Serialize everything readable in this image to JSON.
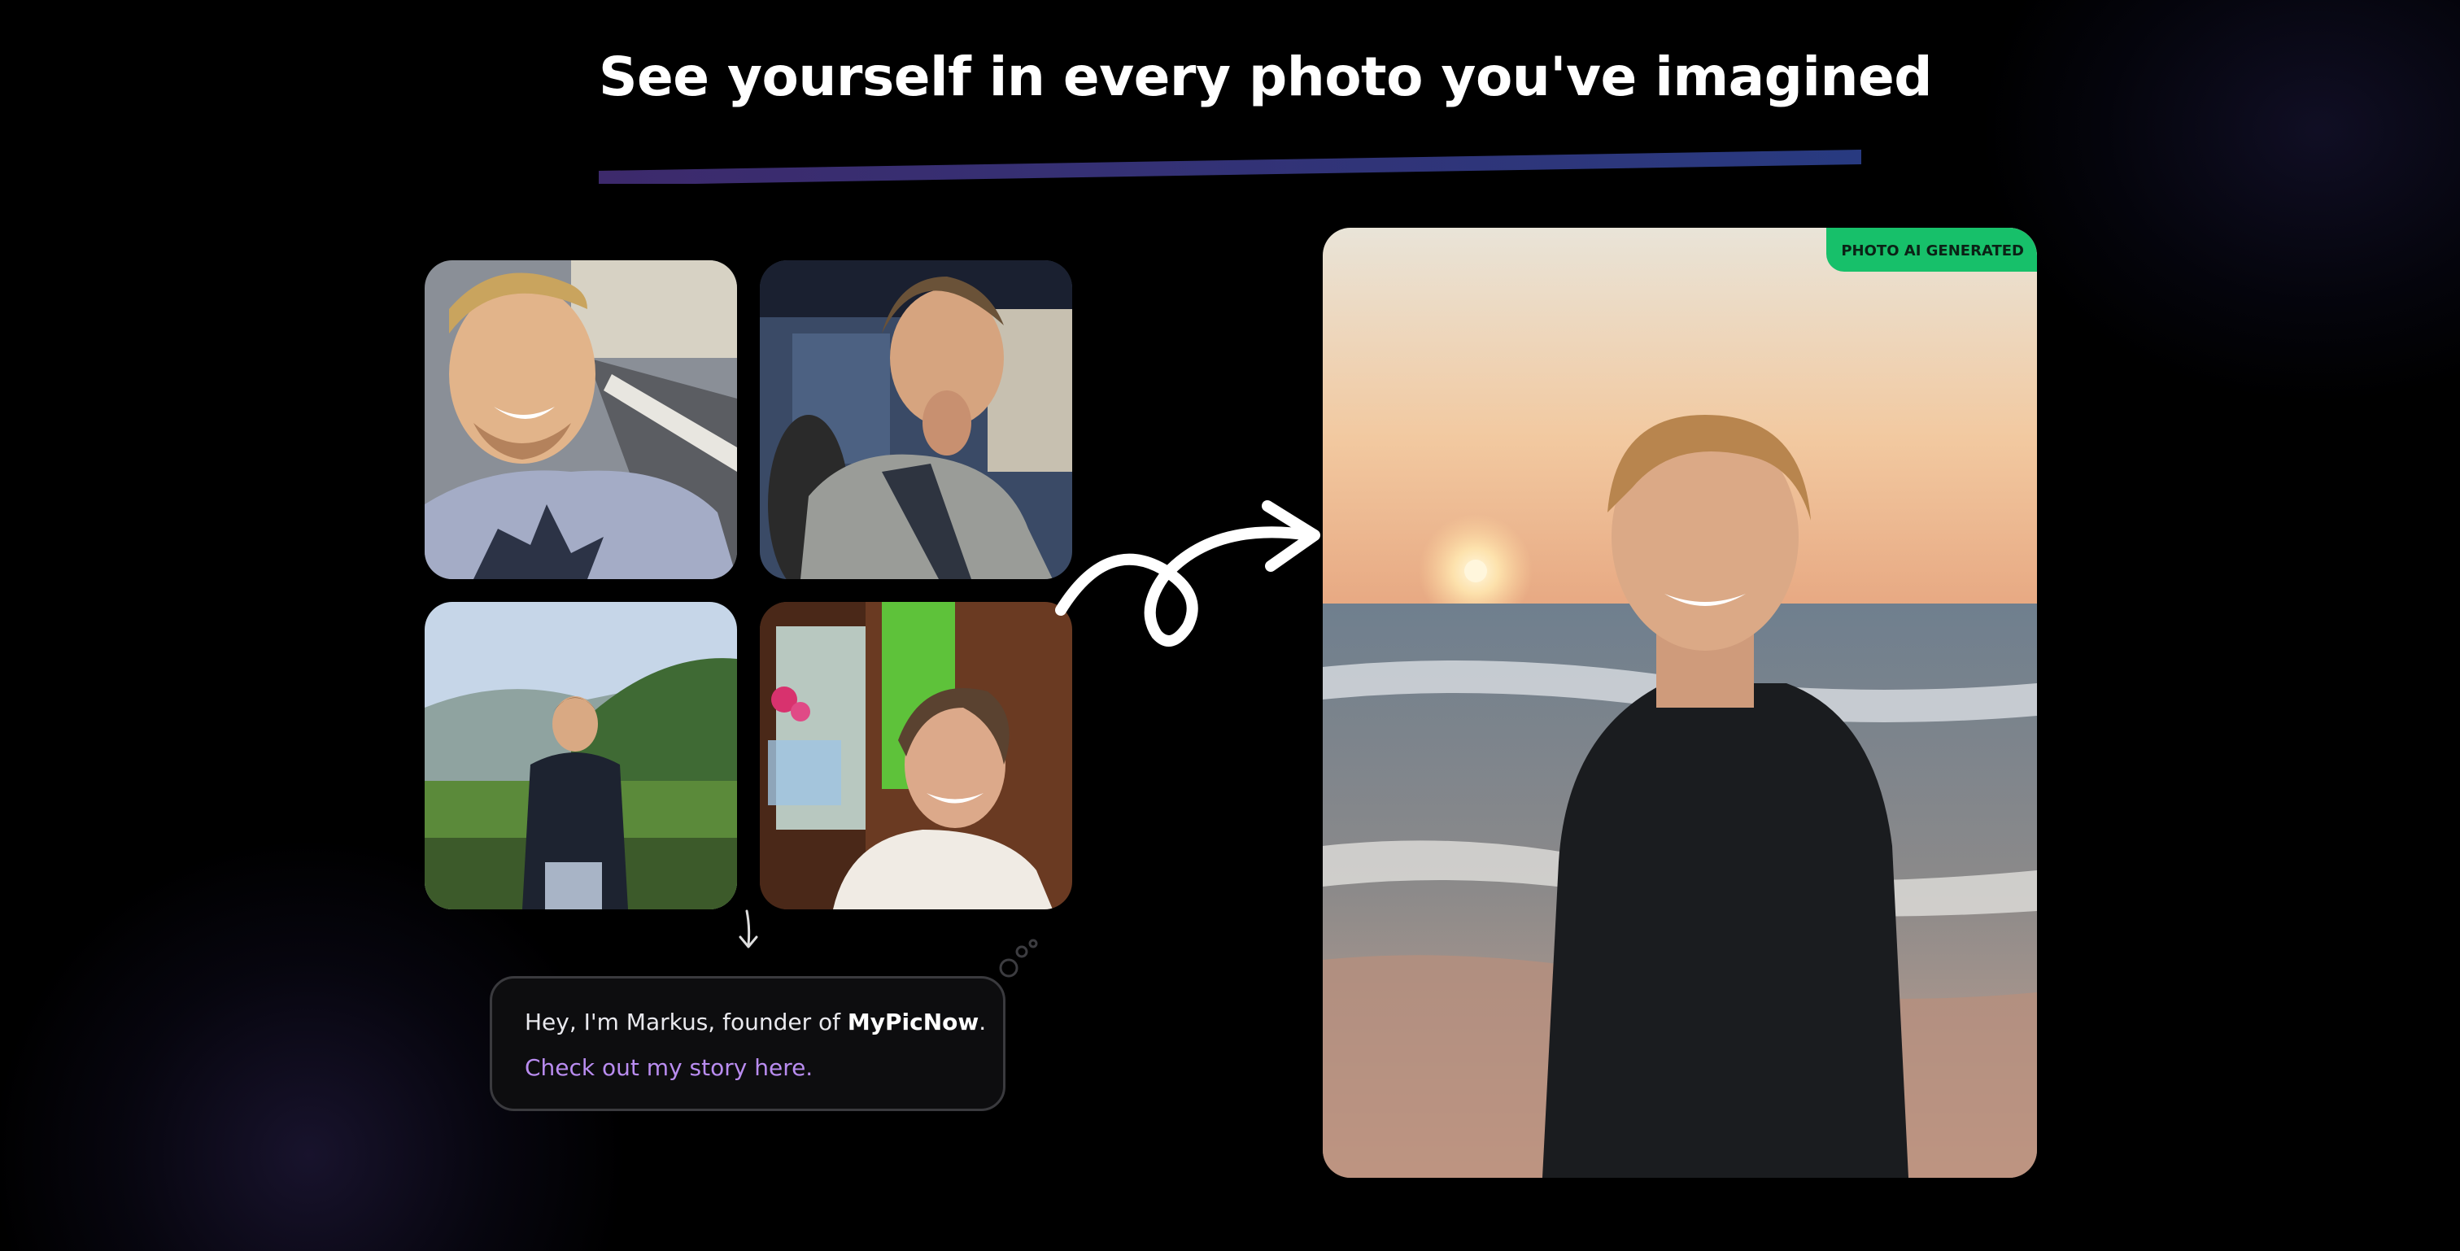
{
  "headline": "See yourself in every photo you've imagined",
  "input_photos": [
    {
      "icon": "portrait-selfie-photo"
    },
    {
      "icon": "portrait-museum-photo"
    },
    {
      "icon": "portrait-hiking-photo"
    },
    {
      "icon": "portrait-indoor-photo"
    }
  ],
  "founder": {
    "intro": "Hey, I'm Markus, founder of ",
    "brand": "MyPicNow",
    "punct": ".",
    "link": "Check out my story here."
  },
  "generated": {
    "badge": "PHOTO AI GENERATED",
    "icon": "beach-sunset-portrait-photo"
  },
  "colors": {
    "background": "#000000",
    "link": "#b98cf0",
    "badge": "#17c06a",
    "underline_start": "#3b2a6a",
    "underline_end": "#2a3a80"
  }
}
